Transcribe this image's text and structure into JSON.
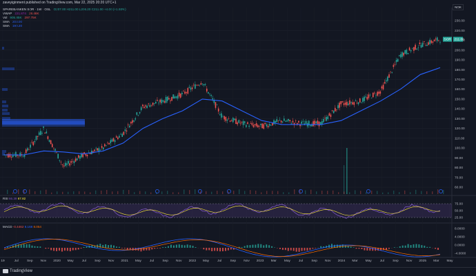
{
  "header": {
    "publisher_line": "zaveyiginment published on TradingView.com, Mar 22, 2025 20:20 UTC+1",
    "currency_button": "NOK"
  },
  "symbol": {
    "title": "SPAREBANKEN SOR · 1W · OSL",
    "ohlc": "O207.00 H211.00 L206.20 C211.00 +4.00 (+1.93%)",
    "vwap_label": "VWAP",
    "vwap_value": "221.874",
    "vwap_value2": "28.48K",
    "vol_label": "Vol",
    "vol_value": "905.85K",
    "vol_value2": "297.75K",
    "sma1_label": "SMA",
    "sma1_value": "203.00",
    "sma2_label": "SMA",
    "sma2_value": "190.20"
  },
  "price_axis": {
    "labels": [
      "230.00",
      "220.00",
      "210.00",
      "200.00",
      "190.00",
      "180.00",
      "170.00",
      "160.00",
      "150.00",
      "140.00",
      "130.00",
      "120.00",
      "110.00",
      "100.00",
      "90.00",
      "80.00",
      "70.00",
      "60.00"
    ],
    "last_price_tag": "211.00",
    "symbol_tag": "SOR"
  },
  "time_axis": {
    "labels": [
      "19",
      "Jul",
      "Sep",
      "Nov",
      "2020",
      "May",
      "Jul",
      "Sep",
      "Nov",
      "2021",
      "May",
      "Jul",
      "Sep",
      "Nov",
      "2022",
      "May",
      "Jul",
      "Sep",
      "Nov",
      "2023",
      "Mar",
      "May",
      "Jul",
      "Sep",
      "Nov",
      "2024",
      "Mar",
      "May",
      "Jul",
      "Sep",
      "Nov",
      "2025",
      "Mar",
      "May"
    ]
  },
  "rsi": {
    "label": "RSI",
    "value1": "66.39",
    "value2": "67.82",
    "axis_labels": [
      "75.00",
      "50.00",
      "25.00"
    ]
  },
  "macd": {
    "label": "MACD",
    "value1": "-0.4462",
    "value2": "8.168",
    "value3": "8.054",
    "axis_labels": [
      "8.0000",
      "4.0000",
      "0.0000",
      "-4.0000"
    ]
  },
  "footer": {
    "brand": "TradingView"
  },
  "colors": {
    "background": "#131722",
    "up": "#26a69a",
    "down": "#ef5350",
    "sma_slow": "#2962ff",
    "rsi_band": "#7e57c2",
    "volume_profile": "#2962ff"
  },
  "chart_data": {
    "type": "line",
    "title": "SPAREBANKEN SOR · 1W · OSL",
    "xlabel": "",
    "ylabel": "",
    "ylim": [
      60,
      230
    ],
    "x": [
      "2019-06",
      "2019-10",
      "2020-01",
      "2020-03",
      "2020-06",
      "2020-10",
      "2021-01",
      "2021-04",
      "2021-07",
      "2021-10",
      "2022-01",
      "2022-03",
      "2022-06",
      "2022-09",
      "2023-01",
      "2023-05",
      "2023-09",
      "2024-01",
      "2024-04",
      "2024-07",
      "2024-10",
      "2025-01",
      "2025-03"
    ],
    "series": [
      {
        "values": [
          93,
          93,
          120,
          81,
          93,
          100,
          115,
          142,
          148,
          155,
          168,
          132,
          125,
          122,
          128,
          125,
          125,
          145,
          148,
          158,
          195,
          205,
          211
        ]
      },
      {
        "values": [
          93,
          93,
          97,
          96,
          94,
          97,
          105,
          120,
          130,
          138,
          150,
          148,
          138,
          128,
          124,
          124,
          124,
          128,
          138,
          148,
          160,
          175,
          182
        ]
      }
    ]
  }
}
